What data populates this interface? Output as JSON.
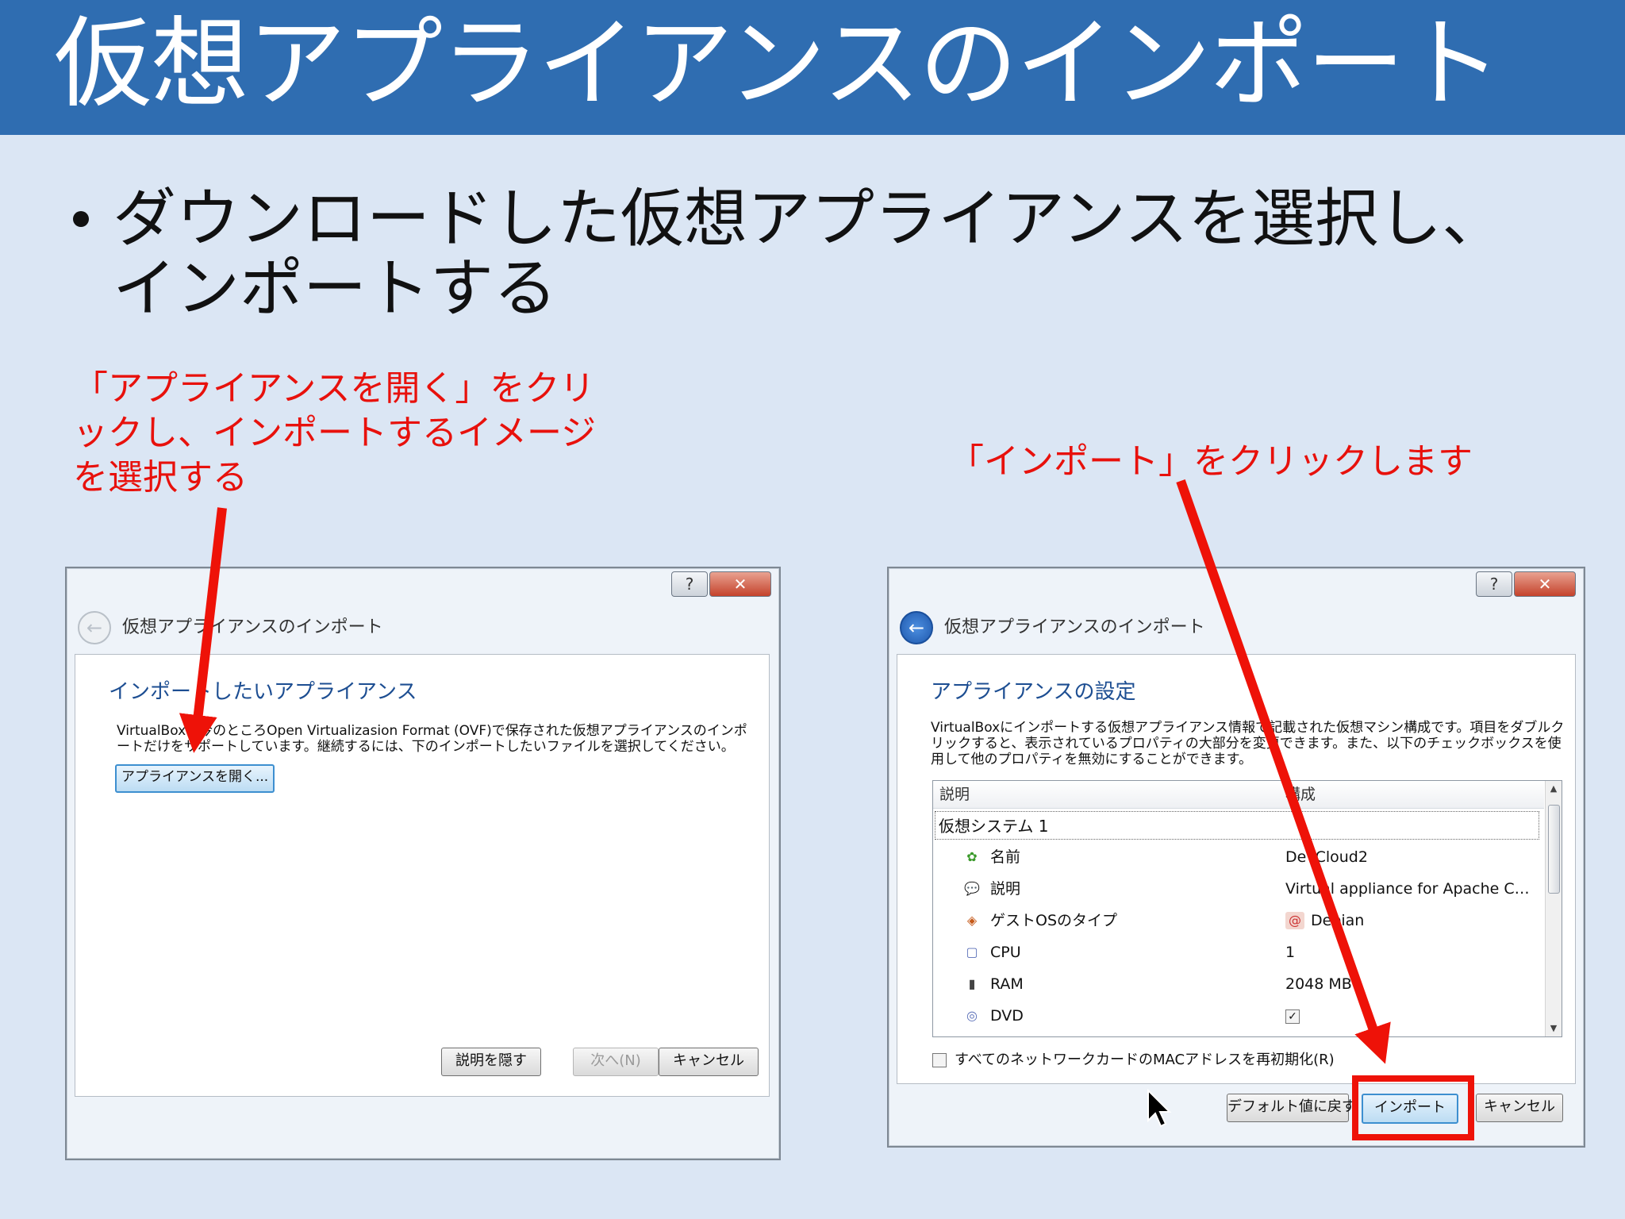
{
  "slide": {
    "title": "仮想アプライアンスのインポート",
    "bullet": "ダウンロードした仮想アプライアンスを選択し、インポートする",
    "annotation_left": "「アプライアンスを開く」をクリックし、インポートするイメージを選択する",
    "annotation_right": "「インポート」をクリックします"
  },
  "colors": {
    "title_bar": "#2f6db1",
    "slide_bg": "#dbe6f4",
    "annotation_red": "#e8110c"
  },
  "dialog1": {
    "help_label": "?",
    "close_label": "✕",
    "back_icon": "back-arrow-icon",
    "title": "仮想アプライアンスのインポート",
    "section_title": "インポートしたいアプライアンス",
    "description": "VirtualBoxは今のところOpen Virtualizasion Format (OVF)で保存された仮想アプライアンスのインポートだけをサポートしています。継続するには、下のインポートしたいファイルを選択してください。",
    "open_button": "アプライアンスを開く...",
    "hide_desc_button": "説明を隠す",
    "next_button": "次へ(N)",
    "cancel_button": "キャンセル"
  },
  "dialog2": {
    "help_label": "?",
    "close_label": "✕",
    "back_icon": "back-arrow-icon",
    "title": "仮想アプライアンスのインポート",
    "section_title": "アプライアンスの設定",
    "description": "VirtualBoxにインポートする仮想アプライアンス情報で記載された仮想マシン構成です。項目をダブルクリックすると、表示されているプロパティの大部分を変更できます。また、以下のチェックボックスを使用して他のプロパティを無効にすることができます。",
    "columns": [
      "説明",
      "構成"
    ],
    "group": "仮想システム 1",
    "rows": [
      {
        "icon": "name-icon",
        "glyph": "✿",
        "label": "名前",
        "value": "DevCloud2"
      },
      {
        "icon": "description-icon",
        "glyph": "💬",
        "label": "説明",
        "value": "Virtual appliance for Apache C…"
      },
      {
        "icon": "guest-os-icon",
        "glyph": "◈",
        "label": "ゲストOSのタイプ",
        "value": "Debian"
      },
      {
        "icon": "cpu-icon",
        "glyph": "▢",
        "label": "CPU",
        "value": "1"
      },
      {
        "icon": "ram-icon",
        "glyph": "▮",
        "label": "RAM",
        "value": "2048 MB"
      },
      {
        "icon": "dvd-icon",
        "glyph": "◎",
        "label": "DVD",
        "value": "✓"
      }
    ],
    "mac_checkbox": "すべてのネットワークカードのMACアドレスを再初期化(R)",
    "default_button": "デフォルト値に戻す",
    "import_button": "インポート",
    "cancel_button": "キャンセル"
  }
}
